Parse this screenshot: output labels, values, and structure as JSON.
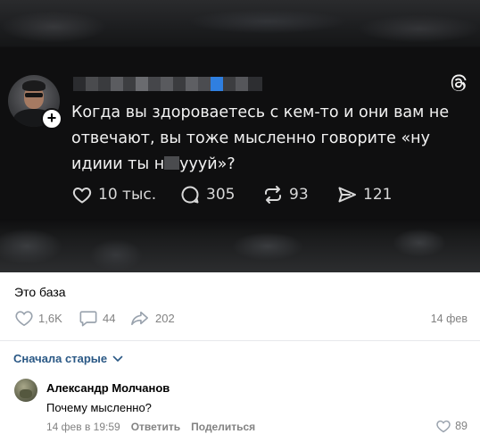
{
  "post_image": {
    "body_text_before": "Когда вы здороваетесь с кем-то и они вам не отвечают, вы тоже мысленно говорите «ну идиии ты н",
    "body_text_after": "уууй»?",
    "stats": {
      "likes": "10 тыс.",
      "comments": "305",
      "reposts": "93",
      "shares": "121"
    }
  },
  "post": {
    "caption": "Это база",
    "likes": "1,6K",
    "comments": "44",
    "shares": "202",
    "date": "14 фев"
  },
  "comments_section": {
    "sort_label": "Сначала старые",
    "items": [
      {
        "author": "Александр Молчанов",
        "text": "Почему мысленно?",
        "time": "14 фев в 19:59",
        "reply_label": "Ответить",
        "share_label": "Поделиться",
        "likes": "89"
      }
    ]
  },
  "colors": {
    "link": "#2a5885",
    "muted": "#828282",
    "dark_bg": "#0f0f10",
    "pixel_blue": "#2f7fe0"
  }
}
